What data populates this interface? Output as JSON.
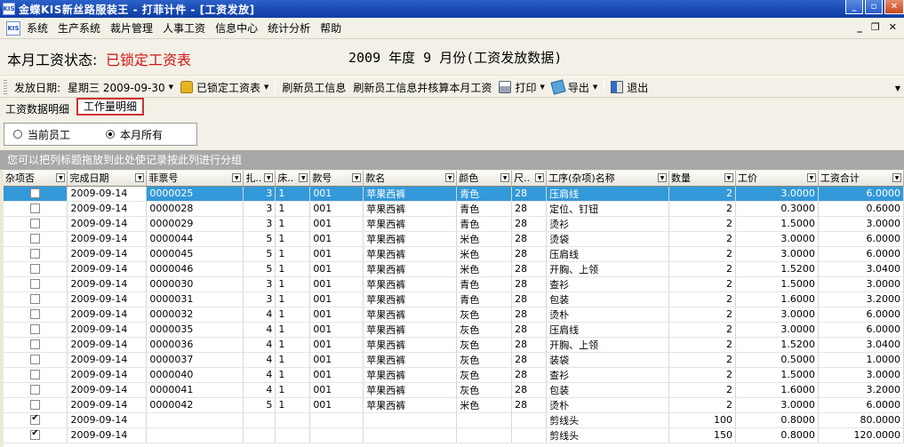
{
  "window": {
    "logo": "KIS",
    "title": "金蝶KIS新丝路服装王 - 打菲计件 - [工资发放]",
    "buttons": [
      "_",
      "▫",
      "✕"
    ]
  },
  "menubar": {
    "logo": "KIS",
    "items": [
      "系统",
      "生产系统",
      "裁片管理",
      "人事工资",
      "信息中心",
      "统计分析",
      "帮助"
    ],
    "mdi_buttons": [
      "_",
      "❐",
      "✕"
    ]
  },
  "status": {
    "label": "本月工资状态:",
    "value": "已锁定工资表",
    "period": "2009 年度 9 月份(工资发放数据)"
  },
  "toolbar": {
    "date_label": "发放日期:",
    "date_value": "星期三 2009-09-30",
    "lock_label": "已锁定工资表",
    "refresh_label": "刷新员工信息",
    "refresh_calc_label": "刷新员工信息并核算本月工资",
    "print_label": "打印",
    "export_label": "导出",
    "exit_label": "退出"
  },
  "tabs": [
    "工资数据明细",
    "工作量明细"
  ],
  "radio": {
    "option1": "当前员工",
    "option2": "本月所有",
    "selected": "本月所有"
  },
  "group_hint": "您可以把列标题拖放到此处使记录按此列进行分组",
  "grid": {
    "columns": [
      "杂项否",
      "完成日期",
      "菲票号",
      "扎..",
      "床..",
      "款号",
      "款名",
      "颜色",
      "尺..",
      "工序(杂项)名称",
      "数量",
      "工价",
      "工资合计"
    ],
    "rows": [
      {
        "misc": false,
        "date": "2009-09-14",
        "ticket": "0000025",
        "bundle": "3",
        "bed": "1",
        "code": "001",
        "style": "苹果西裤",
        "color": "青色",
        "size": "28",
        "process": "压肩线",
        "qty": "2",
        "price": "3.0000",
        "total": "6.0000"
      },
      {
        "misc": false,
        "date": "2009-09-14",
        "ticket": "0000028",
        "bundle": "3",
        "bed": "1",
        "code": "001",
        "style": "苹果西裤",
        "color": "青色",
        "size": "28",
        "process": "定位、钉钮",
        "qty": "2",
        "price": "0.3000",
        "total": "0.6000"
      },
      {
        "misc": false,
        "date": "2009-09-14",
        "ticket": "0000029",
        "bundle": "3",
        "bed": "1",
        "code": "001",
        "style": "苹果西裤",
        "color": "青色",
        "size": "28",
        "process": "烫衫",
        "qty": "2",
        "price": "1.5000",
        "total": "3.0000"
      },
      {
        "misc": false,
        "date": "2009-09-14",
        "ticket": "0000044",
        "bundle": "5",
        "bed": "1",
        "code": "001",
        "style": "苹果西裤",
        "color": "米色",
        "size": "28",
        "process": "烫袋",
        "qty": "2",
        "price": "3.0000",
        "total": "6.0000"
      },
      {
        "misc": false,
        "date": "2009-09-14",
        "ticket": "0000045",
        "bundle": "5",
        "bed": "1",
        "code": "001",
        "style": "苹果西裤",
        "color": "米色",
        "size": "28",
        "process": "压肩线",
        "qty": "2",
        "price": "3.0000",
        "total": "6.0000"
      },
      {
        "misc": false,
        "date": "2009-09-14",
        "ticket": "0000046",
        "bundle": "5",
        "bed": "1",
        "code": "001",
        "style": "苹果西裤",
        "color": "米色",
        "size": "28",
        "process": "开胸、上领",
        "qty": "2",
        "price": "1.5200",
        "total": "3.0400"
      },
      {
        "misc": false,
        "date": "2009-09-14",
        "ticket": "0000030",
        "bundle": "3",
        "bed": "1",
        "code": "001",
        "style": "苹果西裤",
        "color": "青色",
        "size": "28",
        "process": "查衫",
        "qty": "2",
        "price": "1.5000",
        "total": "3.0000"
      },
      {
        "misc": false,
        "date": "2009-09-14",
        "ticket": "0000031",
        "bundle": "3",
        "bed": "1",
        "code": "001",
        "style": "苹果西裤",
        "color": "青色",
        "size": "28",
        "process": "包装",
        "qty": "2",
        "price": "1.6000",
        "total": "3.2000"
      },
      {
        "misc": false,
        "date": "2009-09-14",
        "ticket": "0000032",
        "bundle": "4",
        "bed": "1",
        "code": "001",
        "style": "苹果西裤",
        "color": "灰色",
        "size": "28",
        "process": "烫朴",
        "qty": "2",
        "price": "3.0000",
        "total": "6.0000"
      },
      {
        "misc": false,
        "date": "2009-09-14",
        "ticket": "0000035",
        "bundle": "4",
        "bed": "1",
        "code": "001",
        "style": "苹果西裤",
        "color": "灰色",
        "size": "28",
        "process": "压肩线",
        "qty": "2",
        "price": "3.0000",
        "total": "6.0000"
      },
      {
        "misc": false,
        "date": "2009-09-14",
        "ticket": "0000036",
        "bundle": "4",
        "bed": "1",
        "code": "001",
        "style": "苹果西裤",
        "color": "灰色",
        "size": "28",
        "process": "开胸、上领",
        "qty": "2",
        "price": "1.5200",
        "total": "3.0400"
      },
      {
        "misc": false,
        "date": "2009-09-14",
        "ticket": "0000037",
        "bundle": "4",
        "bed": "1",
        "code": "001",
        "style": "苹果西裤",
        "color": "灰色",
        "size": "28",
        "process": "装袋",
        "qty": "2",
        "price": "0.5000",
        "total": "1.0000"
      },
      {
        "misc": false,
        "date": "2009-09-14",
        "ticket": "0000040",
        "bundle": "4",
        "bed": "1",
        "code": "001",
        "style": "苹果西裤",
        "color": "灰色",
        "size": "28",
        "process": "查衫",
        "qty": "2",
        "price": "1.5000",
        "total": "3.0000"
      },
      {
        "misc": false,
        "date": "2009-09-14",
        "ticket": "0000041",
        "bundle": "4",
        "bed": "1",
        "code": "001",
        "style": "苹果西裤",
        "color": "灰色",
        "size": "28",
        "process": "包装",
        "qty": "2",
        "price": "1.6000",
        "total": "3.2000"
      },
      {
        "misc": false,
        "date": "2009-09-14",
        "ticket": "0000042",
        "bundle": "5",
        "bed": "1",
        "code": "001",
        "style": "苹果西裤",
        "color": "米色",
        "size": "28",
        "process": "烫朴",
        "qty": "2",
        "price": "3.0000",
        "total": "6.0000"
      },
      {
        "misc": true,
        "date": "2009-09-14",
        "ticket": "",
        "bundle": "",
        "bed": "",
        "code": "",
        "style": "",
        "color": "",
        "size": "",
        "process": "剪线头",
        "qty": "100",
        "price": "0.8000",
        "total": "80.0000"
      },
      {
        "misc": true,
        "date": "2009-09-14",
        "ticket": "",
        "bundle": "",
        "bed": "",
        "code": "",
        "style": "",
        "color": "",
        "size": "",
        "process": "剪线头",
        "qty": "150",
        "price": "0.8000",
        "total": "120.0000"
      }
    ]
  }
}
